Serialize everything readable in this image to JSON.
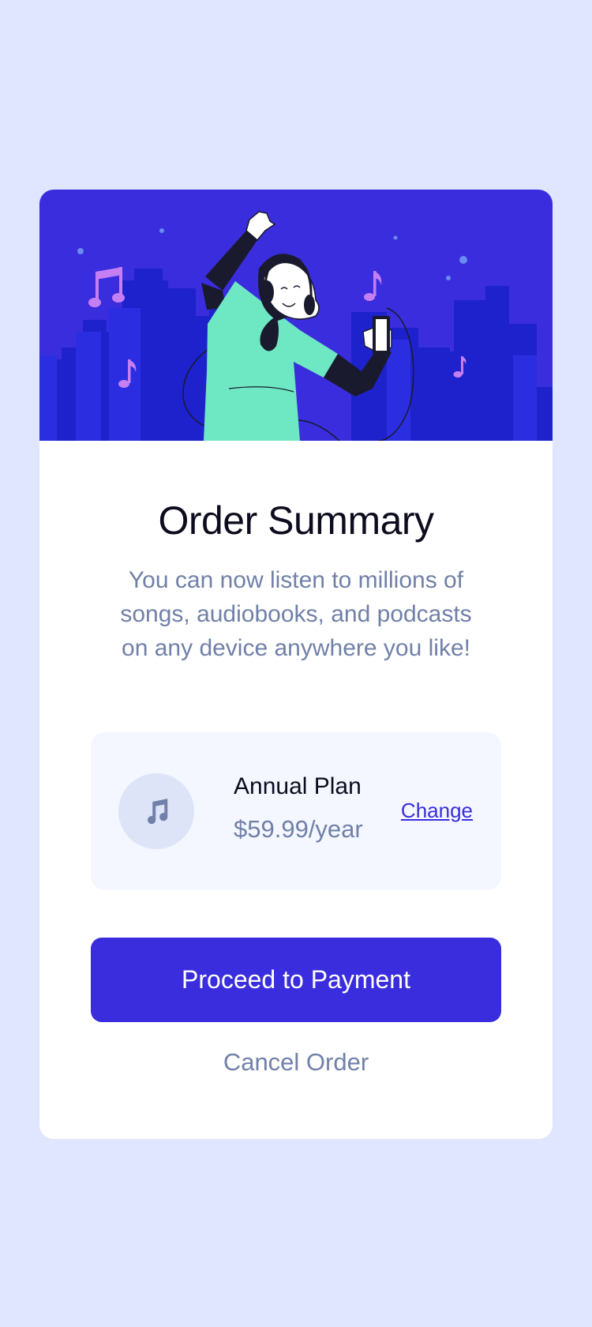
{
  "card": {
    "title": "Order Summary",
    "description": "You can now listen to millions of songs, audiobooks, and podcasts on any device anywhere you like!"
  },
  "plan": {
    "name": "Annual Plan",
    "price": "$59.99/year",
    "change_label": "Change",
    "icon": "music-note-icon"
  },
  "actions": {
    "proceed_label": "Proceed to Payment",
    "cancel_label": "Cancel Order"
  },
  "hero": {
    "illustration": "person-dancing-with-headphones",
    "icons": [
      "music-note-icon",
      "music-note-icon",
      "music-note-icon",
      "music-note-icon"
    ]
  },
  "colors": {
    "page_background": "#e0e6ff",
    "accent": "#3a2ddd",
    "text_dark": "#0c0c1e",
    "text_muted": "#7080a8",
    "plan_background": "#f4f7ff",
    "shirt": "#6ee8c3",
    "notes": "#c67ff2"
  }
}
